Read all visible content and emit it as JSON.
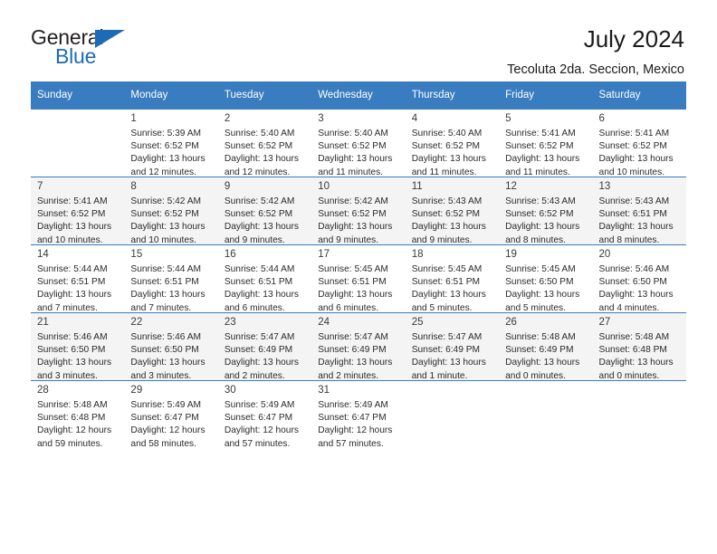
{
  "brand": {
    "name_top": "General",
    "name_bottom": "Blue",
    "accent_color": "#1b6cb5"
  },
  "header": {
    "title": "July 2024",
    "subtitle": "Tecoluta 2da. Seccion, Mexico"
  },
  "calendar": {
    "header_bg": "#3a7cc0",
    "weekday_headers": [
      "Sunday",
      "Monday",
      "Tuesday",
      "Wednesday",
      "Thursday",
      "Friday",
      "Saturday"
    ],
    "weeks": [
      [
        {
          "day": "",
          "sunrise": "",
          "sunset": "",
          "daylight_line1": "",
          "daylight_line2": ""
        },
        {
          "day": "1",
          "sunrise": "Sunrise: 5:39 AM",
          "sunset": "Sunset: 6:52 PM",
          "daylight_line1": "Daylight: 13 hours",
          "daylight_line2": "and 12 minutes."
        },
        {
          "day": "2",
          "sunrise": "Sunrise: 5:40 AM",
          "sunset": "Sunset: 6:52 PM",
          "daylight_line1": "Daylight: 13 hours",
          "daylight_line2": "and 12 minutes."
        },
        {
          "day": "3",
          "sunrise": "Sunrise: 5:40 AM",
          "sunset": "Sunset: 6:52 PM",
          "daylight_line1": "Daylight: 13 hours",
          "daylight_line2": "and 11 minutes."
        },
        {
          "day": "4",
          "sunrise": "Sunrise: 5:40 AM",
          "sunset": "Sunset: 6:52 PM",
          "daylight_line1": "Daylight: 13 hours",
          "daylight_line2": "and 11 minutes."
        },
        {
          "day": "5",
          "sunrise": "Sunrise: 5:41 AM",
          "sunset": "Sunset: 6:52 PM",
          "daylight_line1": "Daylight: 13 hours",
          "daylight_line2": "and 11 minutes."
        },
        {
          "day": "6",
          "sunrise": "Sunrise: 5:41 AM",
          "sunset": "Sunset: 6:52 PM",
          "daylight_line1": "Daylight: 13 hours",
          "daylight_line2": "and 10 minutes."
        }
      ],
      [
        {
          "day": "7",
          "sunrise": "Sunrise: 5:41 AM",
          "sunset": "Sunset: 6:52 PM",
          "daylight_line1": "Daylight: 13 hours",
          "daylight_line2": "and 10 minutes."
        },
        {
          "day": "8",
          "sunrise": "Sunrise: 5:42 AM",
          "sunset": "Sunset: 6:52 PM",
          "daylight_line1": "Daylight: 13 hours",
          "daylight_line2": "and 10 minutes."
        },
        {
          "day": "9",
          "sunrise": "Sunrise: 5:42 AM",
          "sunset": "Sunset: 6:52 PM",
          "daylight_line1": "Daylight: 13 hours",
          "daylight_line2": "and 9 minutes."
        },
        {
          "day": "10",
          "sunrise": "Sunrise: 5:42 AM",
          "sunset": "Sunset: 6:52 PM",
          "daylight_line1": "Daylight: 13 hours",
          "daylight_line2": "and 9 minutes."
        },
        {
          "day": "11",
          "sunrise": "Sunrise: 5:43 AM",
          "sunset": "Sunset: 6:52 PM",
          "daylight_line1": "Daylight: 13 hours",
          "daylight_line2": "and 9 minutes."
        },
        {
          "day": "12",
          "sunrise": "Sunrise: 5:43 AM",
          "sunset": "Sunset: 6:52 PM",
          "daylight_line1": "Daylight: 13 hours",
          "daylight_line2": "and 8 minutes."
        },
        {
          "day": "13",
          "sunrise": "Sunrise: 5:43 AM",
          "sunset": "Sunset: 6:51 PM",
          "daylight_line1": "Daylight: 13 hours",
          "daylight_line2": "and 8 minutes."
        }
      ],
      [
        {
          "day": "14",
          "sunrise": "Sunrise: 5:44 AM",
          "sunset": "Sunset: 6:51 PM",
          "daylight_line1": "Daylight: 13 hours",
          "daylight_line2": "and 7 minutes."
        },
        {
          "day": "15",
          "sunrise": "Sunrise: 5:44 AM",
          "sunset": "Sunset: 6:51 PM",
          "daylight_line1": "Daylight: 13 hours",
          "daylight_line2": "and 7 minutes."
        },
        {
          "day": "16",
          "sunrise": "Sunrise: 5:44 AM",
          "sunset": "Sunset: 6:51 PM",
          "daylight_line1": "Daylight: 13 hours",
          "daylight_line2": "and 6 minutes."
        },
        {
          "day": "17",
          "sunrise": "Sunrise: 5:45 AM",
          "sunset": "Sunset: 6:51 PM",
          "daylight_line1": "Daylight: 13 hours",
          "daylight_line2": "and 6 minutes."
        },
        {
          "day": "18",
          "sunrise": "Sunrise: 5:45 AM",
          "sunset": "Sunset: 6:51 PM",
          "daylight_line1": "Daylight: 13 hours",
          "daylight_line2": "and 5 minutes."
        },
        {
          "day": "19",
          "sunrise": "Sunrise: 5:45 AM",
          "sunset": "Sunset: 6:50 PM",
          "daylight_line1": "Daylight: 13 hours",
          "daylight_line2": "and 5 minutes."
        },
        {
          "day": "20",
          "sunrise": "Sunrise: 5:46 AM",
          "sunset": "Sunset: 6:50 PM",
          "daylight_line1": "Daylight: 13 hours",
          "daylight_line2": "and 4 minutes."
        }
      ],
      [
        {
          "day": "21",
          "sunrise": "Sunrise: 5:46 AM",
          "sunset": "Sunset: 6:50 PM",
          "daylight_line1": "Daylight: 13 hours",
          "daylight_line2": "and 3 minutes."
        },
        {
          "day": "22",
          "sunrise": "Sunrise: 5:46 AM",
          "sunset": "Sunset: 6:50 PM",
          "daylight_line1": "Daylight: 13 hours",
          "daylight_line2": "and 3 minutes."
        },
        {
          "day": "23",
          "sunrise": "Sunrise: 5:47 AM",
          "sunset": "Sunset: 6:49 PM",
          "daylight_line1": "Daylight: 13 hours",
          "daylight_line2": "and 2 minutes."
        },
        {
          "day": "24",
          "sunrise": "Sunrise: 5:47 AM",
          "sunset": "Sunset: 6:49 PM",
          "daylight_line1": "Daylight: 13 hours",
          "daylight_line2": "and 2 minutes."
        },
        {
          "day": "25",
          "sunrise": "Sunrise: 5:47 AM",
          "sunset": "Sunset: 6:49 PM",
          "daylight_line1": "Daylight: 13 hours",
          "daylight_line2": "and 1 minute."
        },
        {
          "day": "26",
          "sunrise": "Sunrise: 5:48 AM",
          "sunset": "Sunset: 6:49 PM",
          "daylight_line1": "Daylight: 13 hours",
          "daylight_line2": "and 0 minutes."
        },
        {
          "day": "27",
          "sunrise": "Sunrise: 5:48 AM",
          "sunset": "Sunset: 6:48 PM",
          "daylight_line1": "Daylight: 13 hours",
          "daylight_line2": "and 0 minutes."
        }
      ],
      [
        {
          "day": "28",
          "sunrise": "Sunrise: 5:48 AM",
          "sunset": "Sunset: 6:48 PM",
          "daylight_line1": "Daylight: 12 hours",
          "daylight_line2": "and 59 minutes."
        },
        {
          "day": "29",
          "sunrise": "Sunrise: 5:49 AM",
          "sunset": "Sunset: 6:47 PM",
          "daylight_line1": "Daylight: 12 hours",
          "daylight_line2": "and 58 minutes."
        },
        {
          "day": "30",
          "sunrise": "Sunrise: 5:49 AM",
          "sunset": "Sunset: 6:47 PM",
          "daylight_line1": "Daylight: 12 hours",
          "daylight_line2": "and 57 minutes."
        },
        {
          "day": "31",
          "sunrise": "Sunrise: 5:49 AM",
          "sunset": "Sunset: 6:47 PM",
          "daylight_line1": "Daylight: 12 hours",
          "daylight_line2": "and 57 minutes."
        },
        {
          "day": "",
          "sunrise": "",
          "sunset": "",
          "daylight_line1": "",
          "daylight_line2": ""
        },
        {
          "day": "",
          "sunrise": "",
          "sunset": "",
          "daylight_line1": "",
          "daylight_line2": ""
        },
        {
          "day": "",
          "sunrise": "",
          "sunset": "",
          "daylight_line1": "",
          "daylight_line2": ""
        }
      ]
    ]
  }
}
